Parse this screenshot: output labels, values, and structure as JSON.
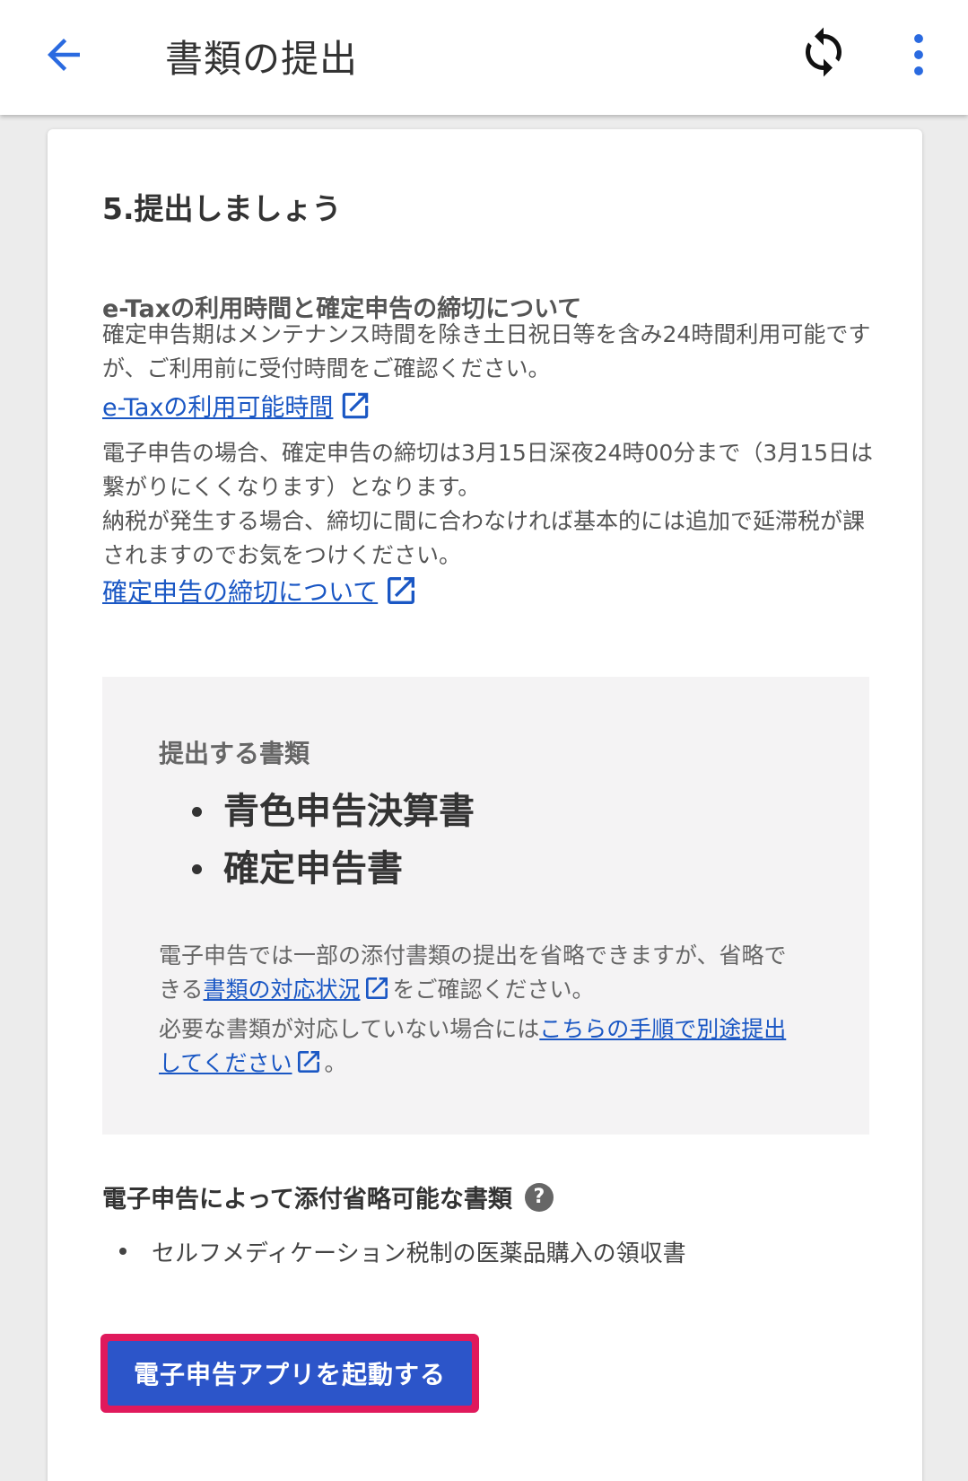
{
  "appbar": {
    "title": "書類の提出",
    "back_icon": "arrow-left-icon",
    "sync_icon": "sync-icon",
    "more_icon": "more-vertical-icon"
  },
  "card": {
    "step_title": "5.提出しましょう",
    "etax_heading": "e-Taxの利用時間と確定申告の締切について",
    "etax_text": "確定申告期はメンテナンス時間を除き土日祝日等を含み24時間利用可能ですが、ご利用前に受付時間をご確認ください。",
    "etax_link": "e-Taxの利用可能時間",
    "deadline_text_1": "電子申告の場合、確定申告の締切は3月15日深夜24時00分まで（3月15日は繋がりにくくなります）となります。",
    "deadline_text_2": "納税が発生する場合、締切に間に合わなければ基本的には追加で延滞税が課されますのでお気をつけください。",
    "deadline_link": "確定申告の締切について",
    "docs": {
      "heading": "提出する書類",
      "items": [
        "青色申告決算書",
        "確定申告書"
      ],
      "note_part1": "電子申告では一部の添付書類の提出を省略できますが、省略できる",
      "note_link1": "書類の対応状況",
      "note_part2": "をご確認ください。",
      "note_part3": "必要な書類が対応していない場合には",
      "note_link2": "こちらの手順で別途提出してください",
      "note_part4": "。"
    },
    "omit": {
      "heading": "電子申告によって添付省略可能な書類",
      "help_icon": "help-circle-icon",
      "help_glyph": "?",
      "items": [
        "セルフメディケーション税制の医薬品購入の領収書"
      ]
    },
    "launch_button": "電子申告アプリを起動する"
  },
  "colors": {
    "link": "#1a57c4",
    "button": "#2c55c9",
    "button_highlight": "#e0195c",
    "back_arrow": "#2a6ae0"
  }
}
